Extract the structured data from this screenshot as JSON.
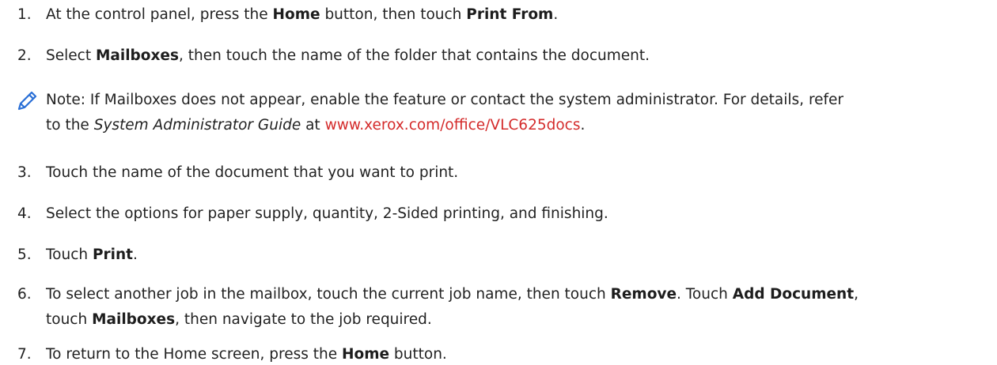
{
  "steps": [
    {
      "num": "1.",
      "l1": [
        "At the control panel, press the ",
        "Home",
        " button, then touch ",
        "Print From",
        "."
      ]
    },
    {
      "num": "2.",
      "l1": [
        "Select ",
        "Mailboxes",
        ", then touch the name of the folder that contains the document."
      ]
    },
    {
      "num": "3.",
      "l1": [
        "Touch the name of the document that you want to print."
      ]
    },
    {
      "num": "4.",
      "l1": [
        "Select the options for paper supply, quantity, 2-Sided printing, and finishing."
      ]
    },
    {
      "num": "5.",
      "l1": [
        "Touch ",
        "Print",
        "."
      ]
    },
    {
      "num": "6.",
      "l1": [
        "To select another job in the mailbox, touch the current job name, then touch ",
        "Remove",
        ". Touch ",
        "Add Document",
        ","
      ],
      "l2": [
        "touch ",
        "Mailboxes",
        ", then navigate to the job required."
      ]
    },
    {
      "num": "7.",
      "l1": [
        "To return to the Home screen, press the ",
        "Home",
        " button."
      ]
    }
  ],
  "note": {
    "icon": "pencil-icon",
    "l1": "Note: If Mailboxes does not appear, enable the feature or contact the system administrator. For details, refer",
    "l2_pre": "to the ",
    "l2_italic": "System Administrator Guide",
    "l2_mid": " at ",
    "l2_link": "www.xerox.com/office/VLC625docs",
    "l2_post": ".",
    "icon_color": "#2a6fd6"
  },
  "link_color": "#d42b2b"
}
